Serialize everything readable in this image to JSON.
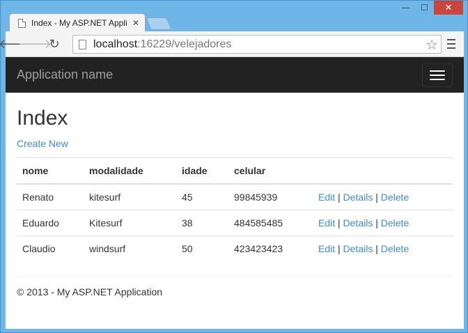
{
  "browser": {
    "tab_title": "Index - My ASP.NET Appli",
    "url_host": "localhost",
    "url_rest": ":16229/velejadores"
  },
  "navbar": {
    "brand": "Application name"
  },
  "page": {
    "title": "Index",
    "create_new": "Create New"
  },
  "table": {
    "headers": [
      "nome",
      "modalidade",
      "idade",
      "celular"
    ],
    "rows": [
      {
        "nome": "Renato",
        "modalidade": "kitesurf",
        "idade": "45",
        "celular": "99845939"
      },
      {
        "nome": "Eduardo",
        "modalidade": "Kitesurf",
        "idade": "38",
        "celular": "484585485"
      },
      {
        "nome": "Claudio",
        "modalidade": "windsurf",
        "idade": "50",
        "celular": "423423423"
      }
    ],
    "actions": {
      "edit": "Edit",
      "details": "Details",
      "delete": "Delete",
      "separator": "|"
    }
  },
  "footer": {
    "text": "© 2013 - My ASP.NET Application"
  }
}
